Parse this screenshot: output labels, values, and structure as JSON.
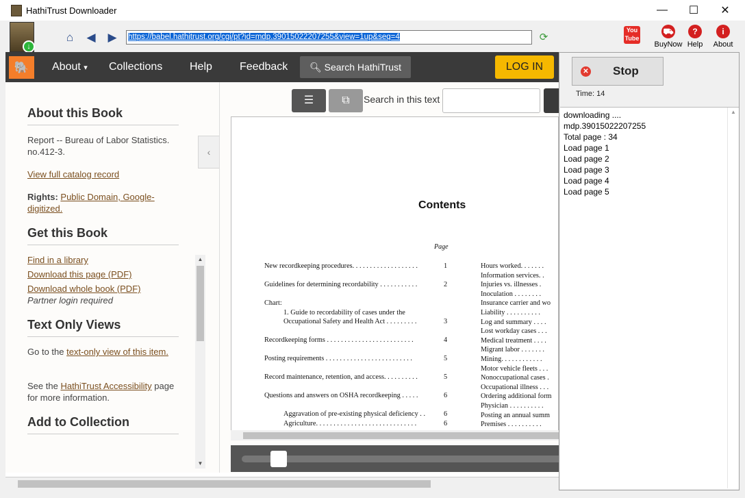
{
  "window": {
    "title": "HathiTrust Downloader",
    "controls": {
      "minimize": "—",
      "maximize": "☐",
      "close": "✕"
    }
  },
  "toolbar": {
    "url": "https://babel.hathitrust.org/cgi/pt?id=mdp.39015022207255&view=1up&seq=4",
    "youtube_label": "You Tube",
    "buynow_label": "BuyNow",
    "help_label": "Help",
    "about_label": "About"
  },
  "site_nav": {
    "about": "About",
    "collections": "Collections",
    "help": "Help",
    "feedback": "Feedback",
    "search": "Search HathiTrust",
    "login": "LOG IN"
  },
  "sidebar": {
    "about_heading": "About this Book",
    "book_title": "Report -- Bureau of Labor Statistics. no.412-3.",
    "catalog_link": "View full catalog record",
    "rights_label": "Rights:",
    "rights_value": "Public Domain, Google-digitized.",
    "get_heading": "Get this Book",
    "find_library": "Find in a library",
    "download_page": "Download this page (PDF)",
    "download_book": "Download whole book (PDF)",
    "partner_note": "Partner login required",
    "text_only_heading": "Text Only Views",
    "text_only_pre": "Go to the",
    "text_only_link": "text-only view of this item.",
    "accessibility_pre": "See the",
    "accessibility_link": "HathiTrust Accessibility",
    "accessibility_post": "page for more information.",
    "collection_heading": "Add to Collection"
  },
  "viewer": {
    "search_label": "Search in this text",
    "page_title": "Contents",
    "page_col_head": "Page",
    "toc_left": [
      {
        "text": "New recordkeeping procedures. . . . . . . . . . . . . . . . . . .",
        "page": "1"
      },
      {
        "text": "Guidelines for determining recordability  . . . . . . . . . . .",
        "page": "2"
      },
      {
        "text": "Chart:",
        "page": ""
      },
      {
        "text": "1.  Guide to recordability of cases under the",
        "page": ""
      },
      {
        "text": "Occupational Safety and Health Act . . . . . . . . .",
        "page": "3"
      },
      {
        "text": "Recordkeeping forms . . . . . . . . . . . . . . . . . . . . . . . . .",
        "page": "4"
      },
      {
        "text": "Posting requirements . . . . . . . . . . . . . . . . . . . . . . . . .",
        "page": "5"
      },
      {
        "text": "Record maintenance, retention, and access. . . . . . . . . .",
        "page": "5"
      },
      {
        "text": "Questions and answers  on OSHA recordkeeping . . . . .",
        "page": "6"
      },
      {
        "text": "Aggravation of pre-existing physical deficiency . .",
        "page": "6"
      },
      {
        "text": "Agriculture. . . . . . . . . . . . . . . . . . . . . . . . . . . . .",
        "page": "6"
      }
    ],
    "toc_right": [
      "Hours worked. . . . . . .",
      "Information services. .",
      "Injuries vs. illnesses .",
      "Inoculation . . . . . . . .",
      "Insurance carrier and wo",
      "Liability  . . . . . . . . . .",
      "Log and summary . . . .",
      "Lost workday cases . . .",
      "Medical treatment . . . .",
      "Migrant labor . . . . . . .",
      "Mining. . . . . . . . . . . .",
      "Motor vehicle fleets . . .",
      "Nonoccupational cases .",
      "Occupational illness . . .",
      "Ordering additional form",
      "Physician . . . . . . . . . .",
      "Posting an annual summ",
      "Premises . . . . . . . . . ."
    ]
  },
  "panel": {
    "stop_label": "Stop",
    "time_label": "Time: 14",
    "log_lines": [
      "downloading ....",
      "mdp.39015022207255",
      "Total page : 34",
      "Load page 1",
      "Load page 2",
      "Load page 3",
      "Load page 4",
      "Load page 5"
    ]
  }
}
